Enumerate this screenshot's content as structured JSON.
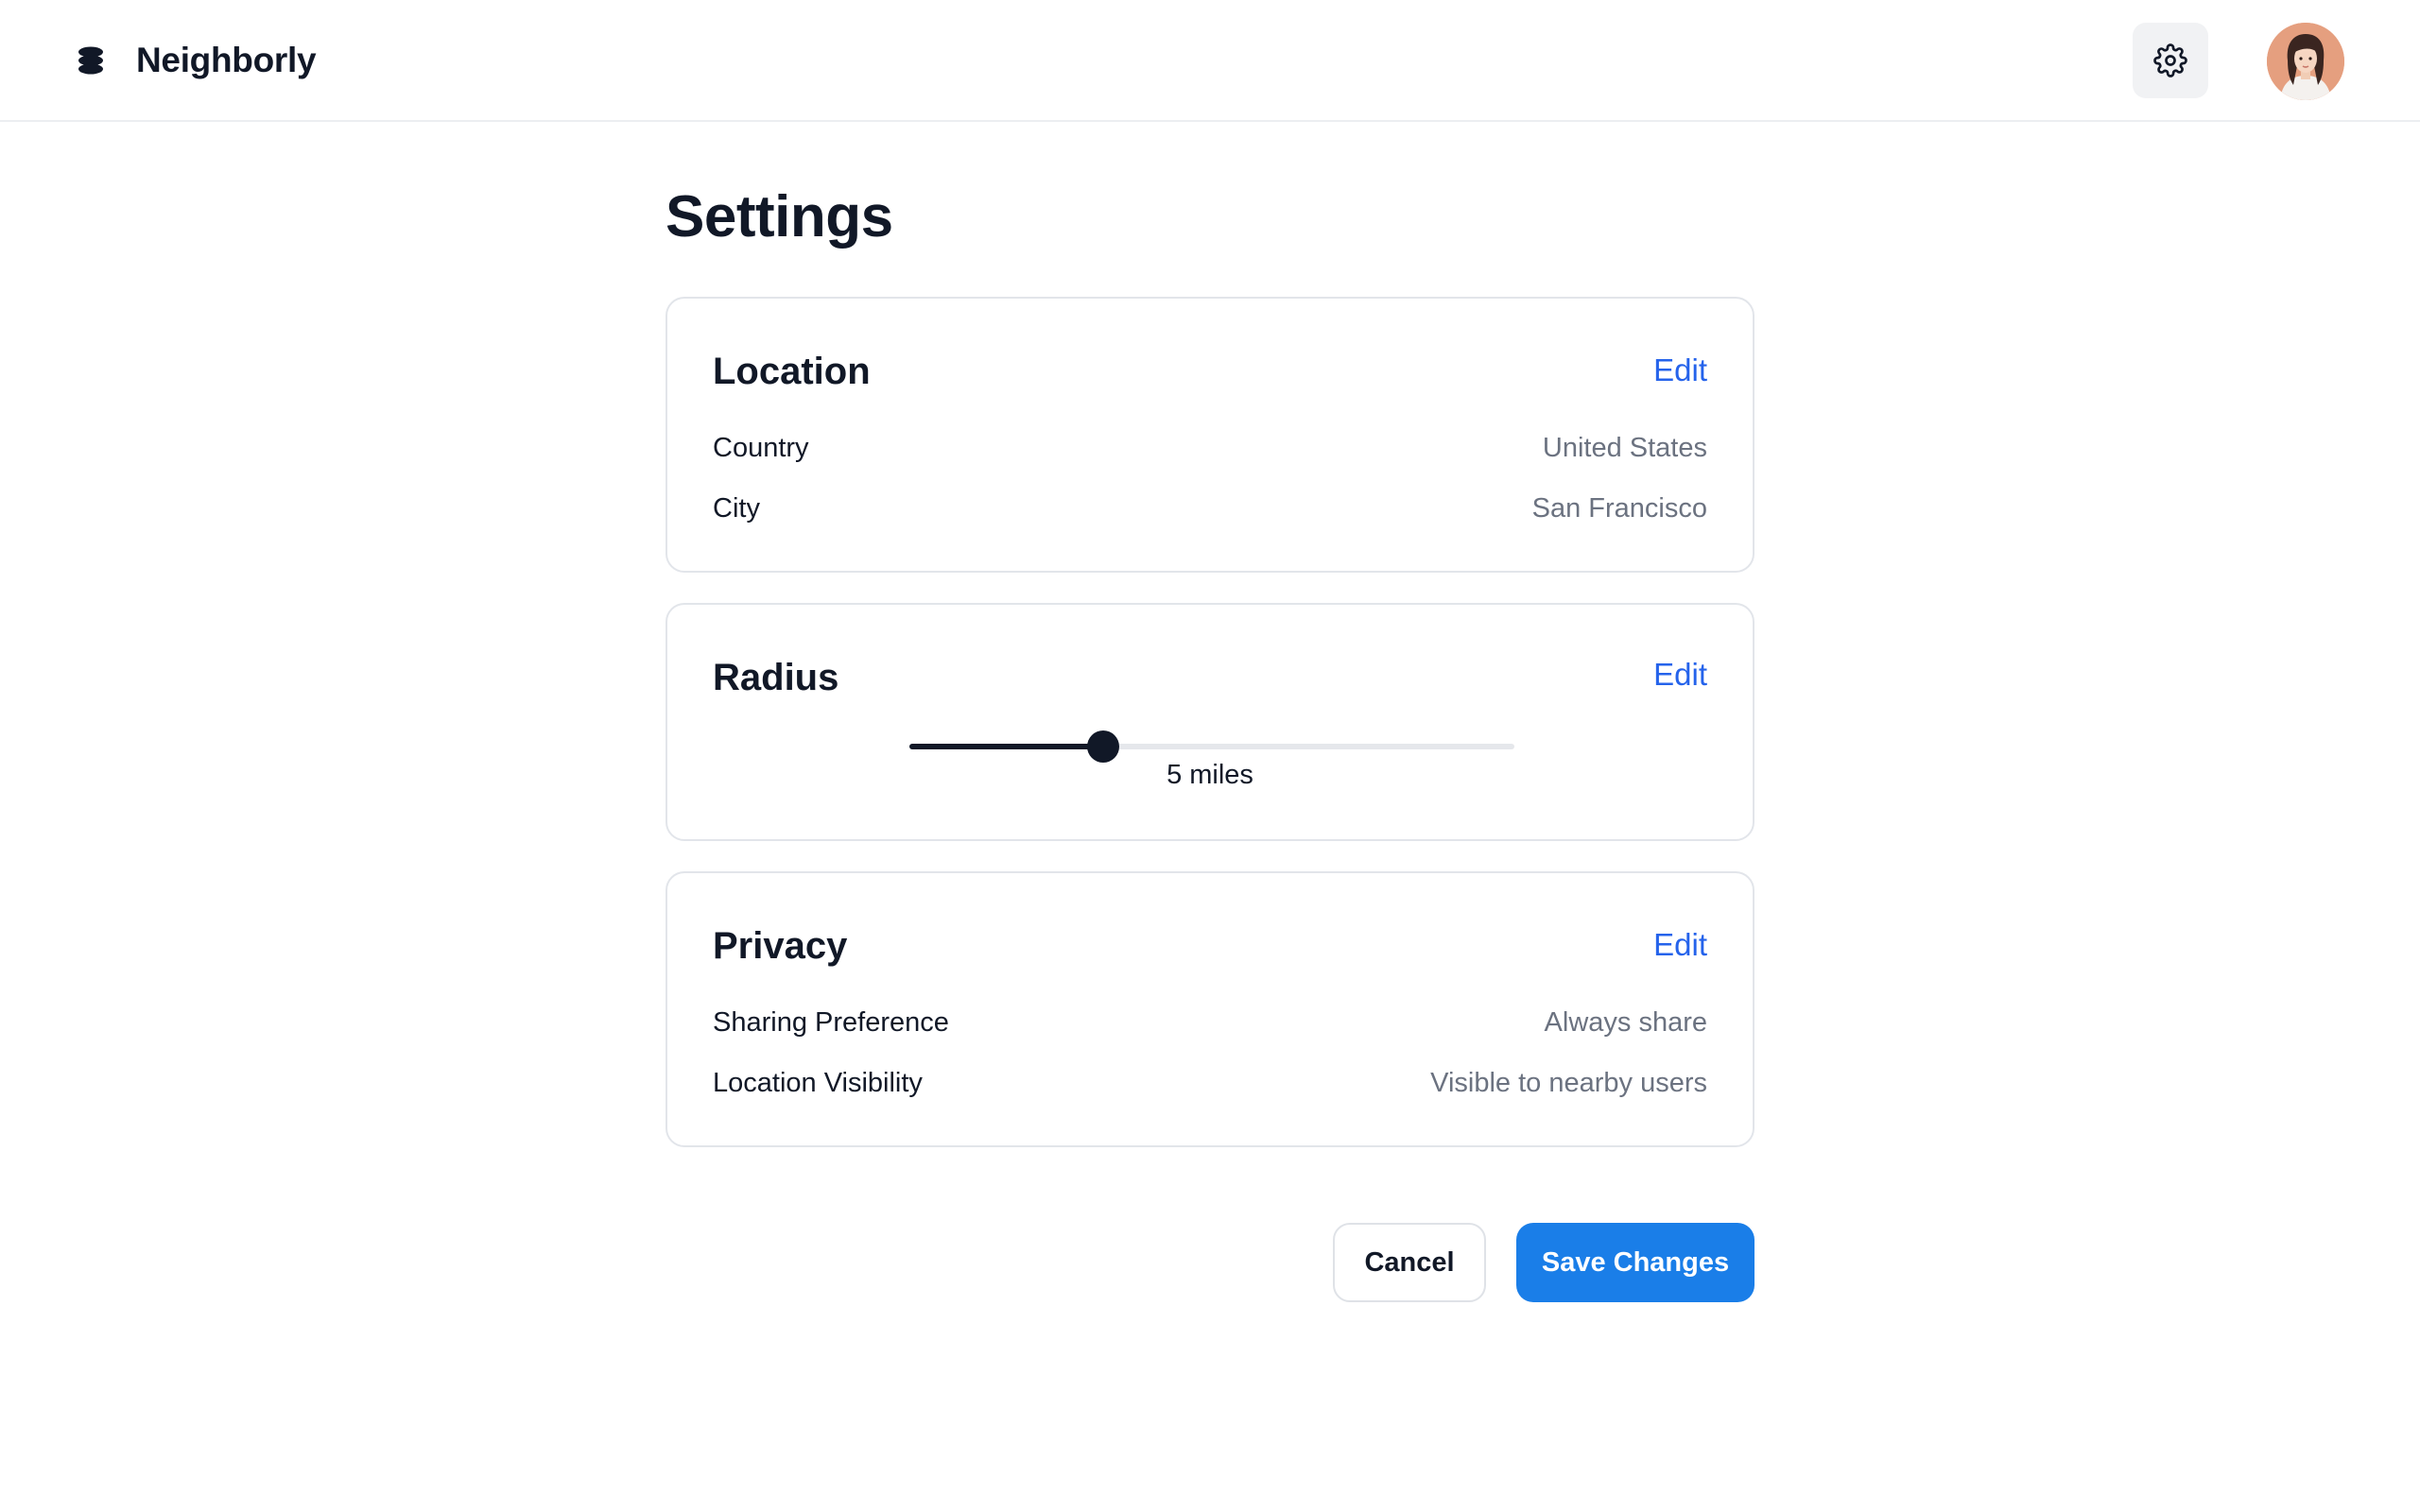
{
  "app": {
    "brand_name": "Neighborly",
    "brand_icon": "stack-logo-icon",
    "settings_icon": "gear-icon",
    "avatar_icon": "user-avatar"
  },
  "page": {
    "title": "Settings"
  },
  "location": {
    "title": "Location",
    "edit_label": "Edit",
    "rows": [
      {
        "label": "Country",
        "value": "United States"
      },
      {
        "label": "City",
        "value": "San Francisco"
      }
    ]
  },
  "radius": {
    "title": "Radius",
    "edit_label": "Edit",
    "slider_fraction": 0.32,
    "value_label": "5 miles"
  },
  "privacy": {
    "title": "Privacy",
    "edit_label": "Edit",
    "rows": [
      {
        "label": "Sharing Preference",
        "value": "Always share"
      },
      {
        "label": "Location Visibility",
        "value": "Visible to nearby users"
      }
    ]
  },
  "actions": {
    "cancel_label": "Cancel",
    "save_label": "Save Changes"
  },
  "colors": {
    "accent": "#2563eb",
    "primary_button": "#1a7ee8",
    "text_primary": "#111827",
    "text_secondary": "#6b7280"
  }
}
